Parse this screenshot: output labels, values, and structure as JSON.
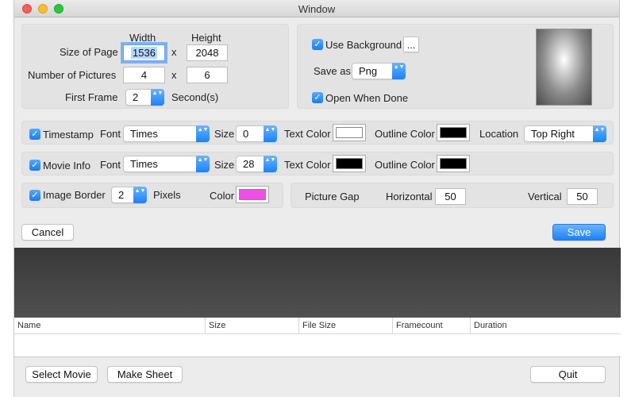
{
  "window": {
    "title": "Window"
  },
  "page": {
    "size_label": "Size of Page",
    "width_header": "Width",
    "height_header": "Height",
    "width_value": "1536",
    "height_value": "2048",
    "times": "x",
    "pictures_label": "Number of Pictures",
    "pictures_cols": "4",
    "pictures_rows": "6",
    "first_frame_label": "First Frame",
    "first_frame_value": "2",
    "first_frame_unit": "Second(s)"
  },
  "background": {
    "use_label": "Use Background",
    "use_checked": true,
    "browse_label": "...",
    "save_as_label": "Save as",
    "save_as_value": "Png",
    "open_done_label": "Open When Done",
    "open_done_checked": true
  },
  "timestamp": {
    "label": "Timestamp",
    "checked": true,
    "font_label": "Font",
    "font_value": "Times",
    "size_label": "Size",
    "size_value": "0",
    "text_color_label": "Text Color",
    "text_color": "#ffffff",
    "outline_color_label": "Outline Color",
    "outline_color": "#000000",
    "location_label": "Location",
    "location_value": "Top Right"
  },
  "movie_info": {
    "label": "Movie Info",
    "checked": true,
    "font_label": "Font",
    "font_value": "Times",
    "size_label": "Size",
    "size_value": "28",
    "text_color_label": "Text Color",
    "text_color": "#000000",
    "outline_color_label": "Outline Color",
    "outline_color": "#000000"
  },
  "border": {
    "label": "Image Border",
    "checked": true,
    "value": "2",
    "unit": "Pixels",
    "color_label": "Color",
    "color": "#f04ee6"
  },
  "gap": {
    "label": "Picture Gap",
    "horizontal_label": "Horizontal",
    "horizontal_value": "50",
    "vertical_label": "Vertical",
    "vertical_value": "50"
  },
  "actions": {
    "cancel": "Cancel",
    "save": "Save"
  },
  "table": {
    "columns": [
      "Name",
      "Size",
      "File Size",
      "Framecount",
      "Duration"
    ]
  },
  "footer": {
    "select_movie": "Select Movie",
    "make_sheet": "Make Sheet",
    "quit": "Quit"
  },
  "colors": {
    "accent": "#1a82fb",
    "check": "✓",
    "updown": "▲▼"
  }
}
